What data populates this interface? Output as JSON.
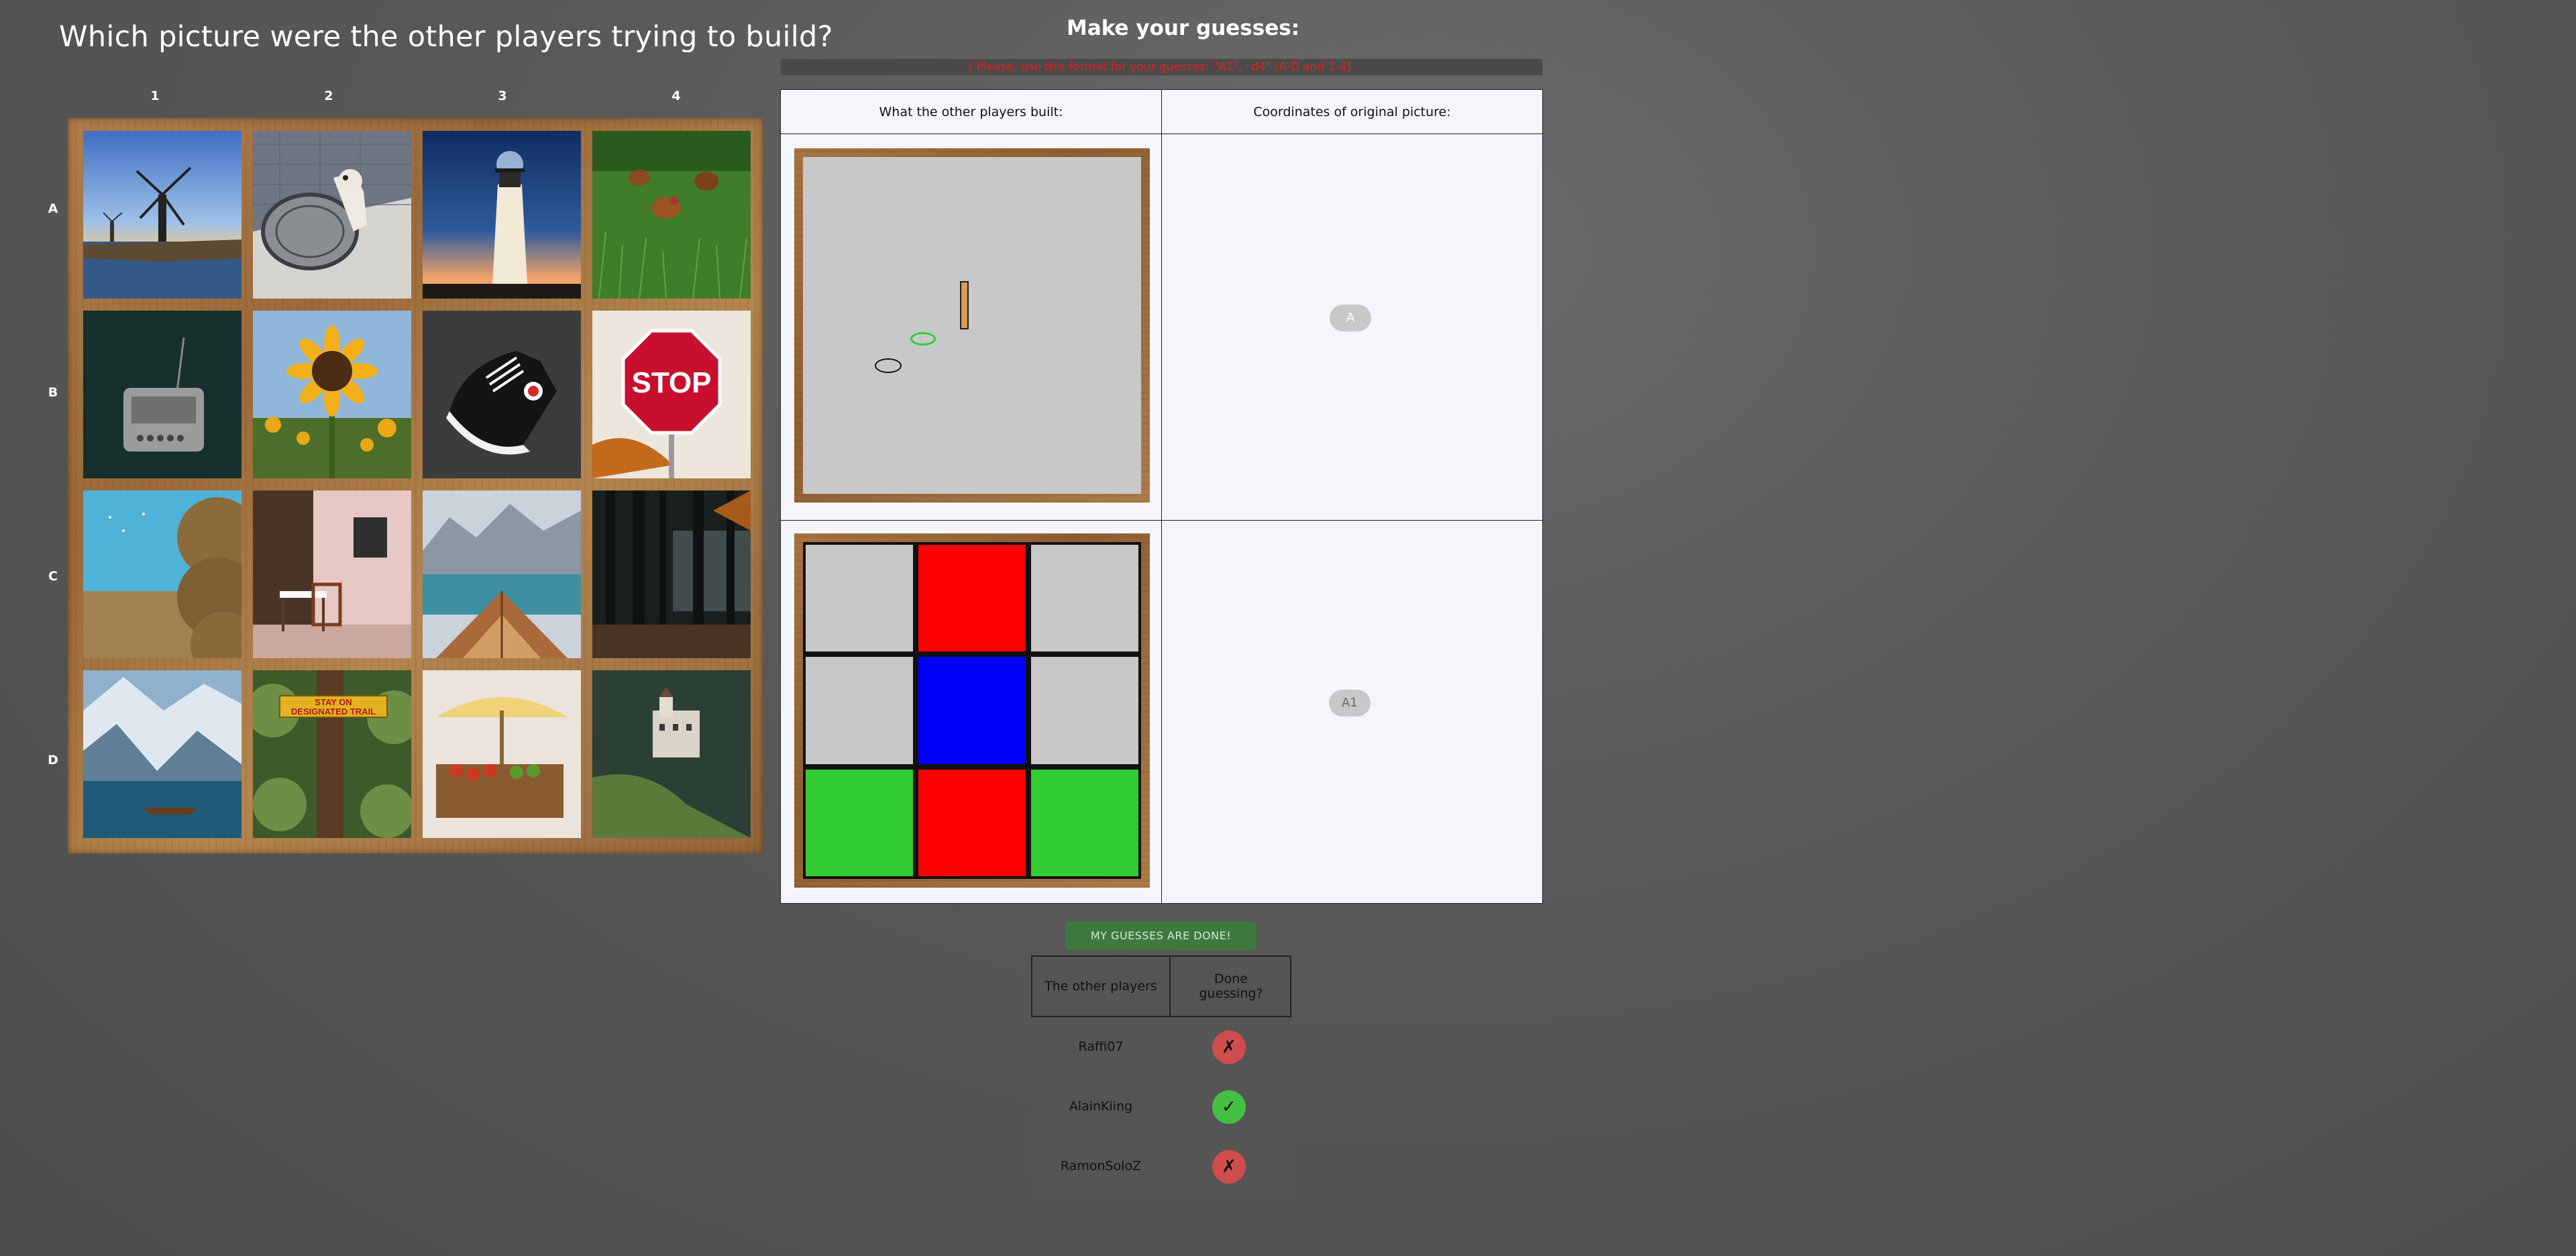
{
  "left_panel": {
    "title": "Which picture were the other players trying to build?",
    "columns": [
      "1",
      "2",
      "3",
      "4"
    ],
    "rows": [
      "A",
      "B",
      "C",
      "D"
    ],
    "tiles": [
      {
        "id": "A1",
        "subject": "windmills-at-dusk"
      },
      {
        "id": "A2",
        "subject": "dog-on-manhole-cover"
      },
      {
        "id": "A3",
        "subject": "lighthouse-at-dusk"
      },
      {
        "id": "A4",
        "subject": "chickens-in-grass"
      },
      {
        "id": "B1",
        "subject": "vintage-radio"
      },
      {
        "id": "B2",
        "subject": "sunflower"
      },
      {
        "id": "B3",
        "subject": "sneaker"
      },
      {
        "id": "B4",
        "subject": "stop-sign"
      },
      {
        "id": "C1",
        "subject": "hay-bales"
      },
      {
        "id": "C2",
        "subject": "cafe-table"
      },
      {
        "id": "C3",
        "subject": "boat-on-lake"
      },
      {
        "id": "C4",
        "subject": "forest"
      },
      {
        "id": "D1",
        "subject": "mountain-lake-boat"
      },
      {
        "id": "D2",
        "subject": "trail-sign"
      },
      {
        "id": "D3",
        "subject": "market-stall"
      },
      {
        "id": "D4",
        "subject": "castle-on-cliff"
      }
    ],
    "tile_text": {
      "stop_sign": "STOP",
      "trail_sign_line1": "STAY ON",
      "trail_sign_line2": "DESIGNATED TRAIL"
    }
  },
  "guess_panel": {
    "title": "Make your guesses:",
    "warning": "! Please, use this format for your guesses: \"A1\", \"d4\" (A-D and 1-4).",
    "col_built": "What the other players built:",
    "col_coords": "Coordinates of original picture:",
    "builds": [
      {
        "guess": "A",
        "pieces": "sparse"
      },
      {
        "guess": "A1",
        "grid_colors": [
          "#c8c8c8",
          "#ff0000",
          "#c8c8c8",
          "#c8c8c8",
          "#0000ff",
          "#c8c8c8",
          "#33cc33",
          "#ff0000",
          "#33cc33"
        ]
      }
    ],
    "done_button": "MY GUESSES ARE DONE!"
  },
  "players_panel": {
    "col_players": "The other players",
    "col_done": "Done guessing?",
    "players": [
      {
        "name": "Raffi07",
        "done": false,
        "mark": "✗"
      },
      {
        "name": "AlainKiing",
        "done": true,
        "mark": "✓"
      },
      {
        "name": "RamonSoloZ",
        "done": false,
        "mark": "✗"
      }
    ]
  }
}
